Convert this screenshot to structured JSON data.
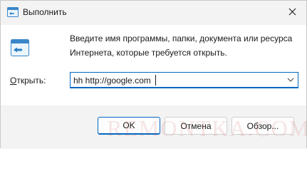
{
  "window": {
    "title": "Выполнить",
    "close_icon": "close-icon"
  },
  "description": "Введите имя программы, папки, документа или ресурса Интернета, которые требуется открыть.",
  "open": {
    "label_prefix": "О",
    "label_rest": "ткрыть:",
    "value": "hh http://google.com",
    "dropdown_icon": "chevron-down-icon"
  },
  "buttons": {
    "ok": "OK",
    "cancel": "Отмена",
    "browse": "Обзор..."
  },
  "watermark": "REMONTKA.COM",
  "colors": {
    "accent": "#0067c0",
    "background": "#f3f3f3",
    "content": "#ffffff"
  }
}
